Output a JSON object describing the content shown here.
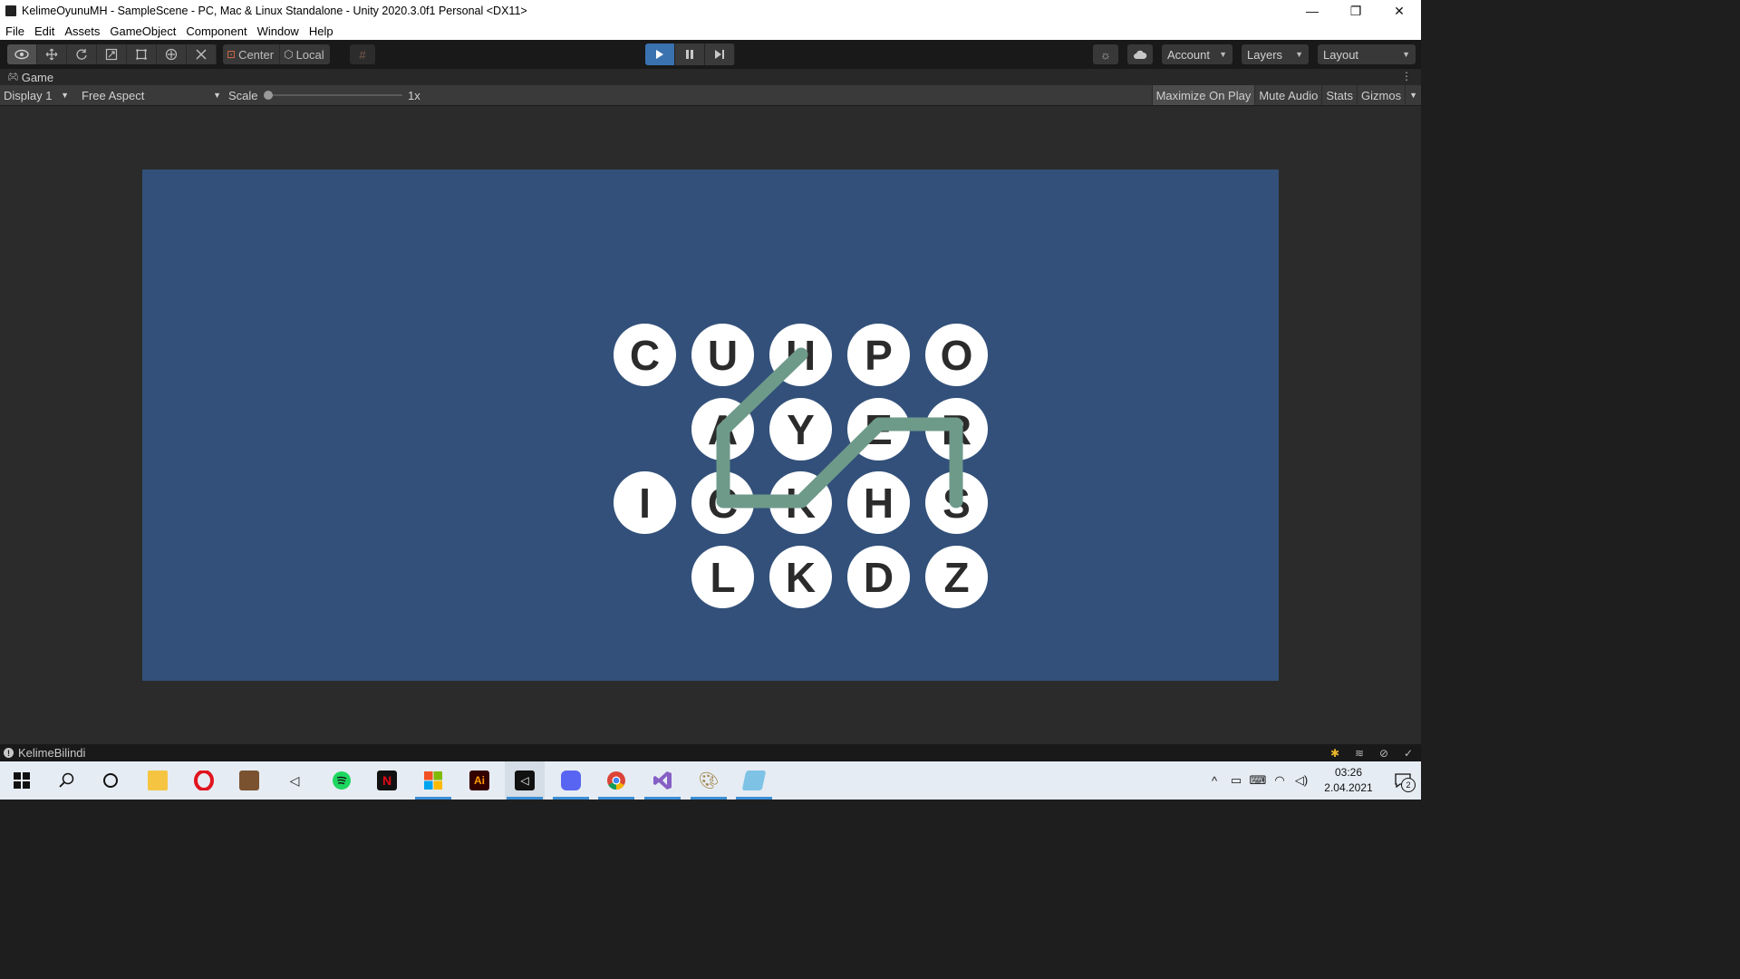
{
  "window": {
    "title": "KelimeOyunuMH - SampleScene - PC, Mac & Linux Standalone - Unity 2020.3.0f1 Personal <DX11>",
    "controls": {
      "minimize": "—",
      "restore": "❐",
      "close": "✕"
    }
  },
  "menu": [
    "File",
    "Edit",
    "Assets",
    "GameObject",
    "Component",
    "Window",
    "Help"
  ],
  "toolbar": {
    "tools": [
      "view-tool",
      "move-tool",
      "rotate-tool",
      "scale-tool",
      "rect-tool",
      "transform-tool",
      "custom-tool"
    ],
    "pivot_mode": "Center",
    "pivot_rotation": "Local",
    "account": "Account",
    "layers": "Layers",
    "layout": "Layout"
  },
  "game_tab": {
    "label": "Game"
  },
  "game_toolbar": {
    "display": "Display 1",
    "aspect": "Free Aspect",
    "scale_label": "Scale",
    "scale_value": "1x",
    "scale_level": 0.0,
    "maximize_on_play": "Maximize On Play",
    "mute_audio": "Mute Audio",
    "stats": "Stats",
    "gizmos": "Gizmos"
  },
  "game": {
    "background_color": "#32507a",
    "bubble_color": "#ffffff",
    "letter_color": "#2b2b2b",
    "path_color": "#6e9a8a",
    "letters": {
      "r0c0": "C",
      "r0c1": "U",
      "r0c2": "H",
      "r0c3": "P",
      "r0c4": "O",
      "r1c1": "A",
      "r1c2": "Y",
      "r1c3": "E",
      "r1c4": "R",
      "r2c0": "I",
      "r2c1": "C",
      "r2c2": "K",
      "r2c3": "H",
      "r2c4": "S",
      "r3c1": "L",
      "r3c2": "K",
      "r3c3": "D",
      "r3c4": "Z"
    }
  },
  "status": {
    "message": "KelimeBilindi"
  },
  "taskbar": {
    "apps": [
      "windows-start",
      "search",
      "cortana",
      "file-explorer",
      "opera",
      "minecraft",
      "unity-hub",
      "spotify",
      "netflix",
      "microsoft-store",
      "adobe-illustrator",
      "unity",
      "discord",
      "chrome",
      "visual-studio",
      "paint",
      "notepad"
    ],
    "illustrator_label": "Ai",
    "netflix_label": "N",
    "time": "03:26",
    "date": "2.04.2021",
    "notifications": "2"
  }
}
